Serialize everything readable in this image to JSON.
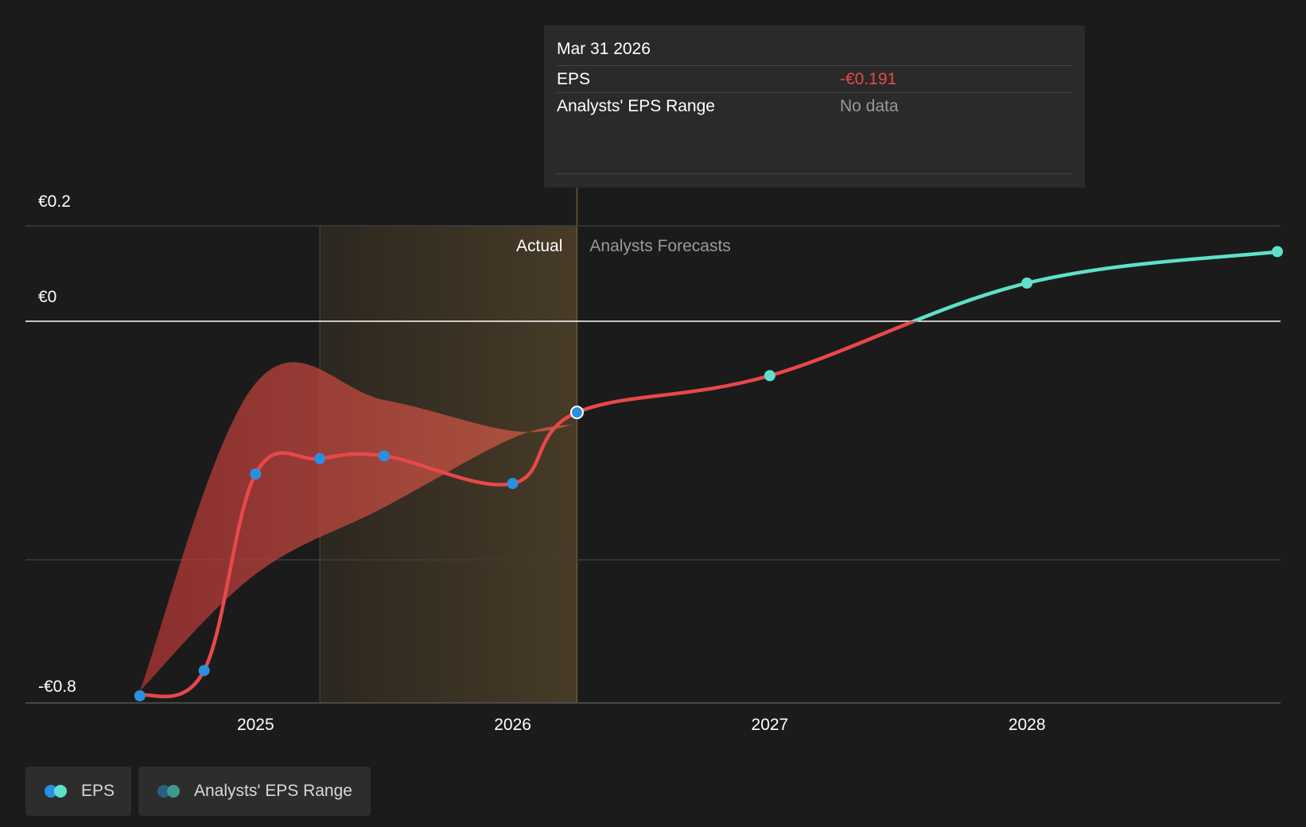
{
  "chart_data": {
    "type": "line",
    "y_ticks": [
      {
        "label": "€0.2",
        "value": 0.2
      },
      {
        "label": "€0",
        "value": 0
      },
      {
        "label": "-€0.8",
        "value": -0.8
      }
    ],
    "x_ticks": [
      {
        "label": "2025",
        "value": 2025.0
      },
      {
        "label": "2026",
        "value": 2026.0
      },
      {
        "label": "2027",
        "value": 2027.0
      },
      {
        "label": "2028",
        "value": 2028.0
      }
    ],
    "xlim": [
      2024.3,
      2028.98
    ],
    "ylim": [
      -0.8,
      0.2
    ],
    "actual_label": "Actual",
    "forecast_label": "Analysts Forecasts",
    "actual_region": [
      2025.25,
      2026.25
    ],
    "series": [
      {
        "name": "EPS",
        "actual": [
          {
            "x": 2024.55,
            "y": -0.785
          },
          {
            "x": 2024.8,
            "y": -0.732
          },
          {
            "x": 2025.0,
            "y": -0.32
          },
          {
            "x": 2025.25,
            "y": -0.288
          },
          {
            "x": 2025.5,
            "y": -0.282
          },
          {
            "x": 2026.0,
            "y": -0.34
          },
          {
            "x": 2026.25,
            "y": -0.191
          }
        ],
        "forecast": [
          {
            "x": 2027.0,
            "y": -0.114
          },
          {
            "x": 2028.0,
            "y": 0.08
          },
          {
            "x": 2028.98,
            "y": 0.146
          }
        ]
      }
    ],
    "range_band": {
      "name": "Analysts' EPS Range",
      "upper": [
        {
          "x": 2024.55,
          "y": -0.775
        },
        {
          "x": 2025.0,
          "y": -0.13
        },
        {
          "x": 2025.5,
          "y": -0.165
        },
        {
          "x": 2026.0,
          "y": -0.23
        },
        {
          "x": 2026.25,
          "y": -0.215
        }
      ],
      "lower": [
        {
          "x": 2026.25,
          "y": -0.215
        },
        {
          "x": 2026.0,
          "y": -0.245
        },
        {
          "x": 2025.5,
          "y": -0.39
        },
        {
          "x": 2025.0,
          "y": -0.53
        },
        {
          "x": 2024.55,
          "y": -0.775
        }
      ]
    },
    "colors": {
      "background": "#1b1b1b",
      "eps_negative": "#e8484a",
      "eps_positive": "#5ee0cc",
      "actual_point": "#2b8fe0",
      "forecast_point": "#5ee0cc",
      "band": "#b03535",
      "actual_region": "#4a3d28",
      "gridline": "#3d3d3d",
      "zero_line": "#ffffff"
    }
  },
  "tooltip": {
    "date": "Mar 31 2026",
    "rows": [
      {
        "label": "EPS",
        "value": "-€0.191"
      },
      {
        "label": "Analysts' EPS Range",
        "value": "No data"
      }
    ]
  },
  "legend": {
    "eps_label": "EPS",
    "range_label": "Analysts' EPS Range",
    "eps_colors": [
      "#2b8fe0",
      "#5ee0cc"
    ],
    "range_colors": [
      "#2a5f80",
      "#3f9a8c"
    ]
  }
}
